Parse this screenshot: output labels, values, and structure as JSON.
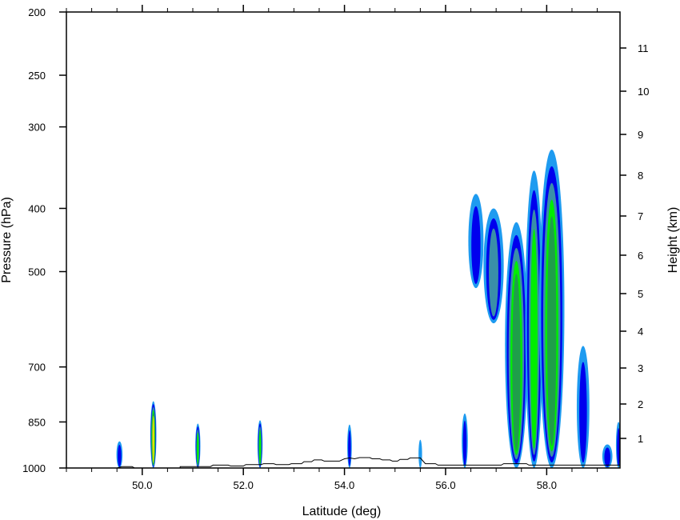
{
  "chart_data": {
    "type": "heatmap",
    "title": "",
    "xlabel": "Latitude (deg)",
    "ylabel": "Pressure (hPa)",
    "y2label": "Height (km)",
    "xlim": [
      48.5,
      59.45
    ],
    "ylim_pressure": [
      1000,
      200
    ],
    "y_scale": "log",
    "x_ticks": [
      "50.0",
      "52.0",
      "54.0",
      "56.0",
      "58.0"
    ],
    "x_tick_values": [
      50,
      52,
      54,
      56,
      58
    ],
    "y_ticks": [
      "200",
      "250",
      "300",
      "400",
      "500",
      "700",
      "850",
      "1000"
    ],
    "y_tick_values": [
      200,
      250,
      300,
      400,
      500,
      700,
      850,
      1000
    ],
    "y2_ticks": [
      "1",
      "2",
      "3",
      "4",
      "5",
      "6",
      "7",
      "8",
      "9",
      "10",
      "11"
    ],
    "y2_tick_values": [
      1,
      2,
      3,
      4,
      5,
      6,
      7,
      8,
      9,
      10,
      11
    ],
    "grid": false,
    "legend": "none",
    "colors": {
      "level1": "#1e9bf0",
      "level2": "#0000ee",
      "level3": "#3a8fa8",
      "level4": "#00ee00",
      "level5": "#1f9e4a",
      "level6": "#e6e600"
    },
    "cells": [
      {
        "lat": 49.55,
        "p_top": 910,
        "p_bottom": 1000,
        "w": 0.12,
        "levels": 2
      },
      {
        "lat": 50.22,
        "p_top": 790,
        "p_bottom": 1000,
        "w": 0.12,
        "levels": 6
      },
      {
        "lat": 51.1,
        "p_top": 855,
        "p_bottom": 1000,
        "w": 0.1,
        "levels": 4
      },
      {
        "lat": 52.33,
        "p_top": 845,
        "p_bottom": 1000,
        "w": 0.1,
        "levels": 4
      },
      {
        "lat": 54.1,
        "p_top": 858,
        "p_bottom": 1000,
        "w": 0.09,
        "levels": 2
      },
      {
        "lat": 55.5,
        "p_top": 905,
        "p_bottom": 1000,
        "w": 0.07,
        "levels": 1
      },
      {
        "lat": 56.38,
        "p_top": 825,
        "p_bottom": 1000,
        "w": 0.12,
        "levels": 2
      },
      {
        "lat": 56.6,
        "p_top": 380,
        "p_bottom": 530,
        "w": 0.3,
        "levels": 2
      },
      {
        "lat": 56.95,
        "p_top": 400,
        "p_bottom": 600,
        "w": 0.4,
        "levels": 3
      },
      {
        "lat": 57.4,
        "p_top": 420,
        "p_bottom": 1000,
        "w": 0.45,
        "levels": 5
      },
      {
        "lat": 57.75,
        "p_top": 350,
        "p_bottom": 1000,
        "w": 0.35,
        "levels": 4
      },
      {
        "lat": 58.1,
        "p_top": 325,
        "p_bottom": 1000,
        "w": 0.5,
        "levels": 5
      },
      {
        "lat": 58.72,
        "p_top": 650,
        "p_bottom": 1000,
        "w": 0.25,
        "levels": 2
      },
      {
        "lat": 59.2,
        "p_top": 920,
        "p_bottom": 1000,
        "w": 0.2,
        "levels": 2
      },
      {
        "lat": 59.42,
        "p_top": 850,
        "p_bottom": 1000,
        "w": 0.1,
        "levels": 2
      }
    ],
    "terrain": [
      [
        48.5,
        1000
      ],
      [
        49.5,
        1000
      ],
      [
        49.6,
        995
      ],
      [
        49.8,
        995
      ],
      [
        49.85,
        1000
      ],
      [
        50.75,
        1000
      ],
      [
        50.75,
        995
      ],
      [
        51.35,
        995
      ],
      [
        51.4,
        990
      ],
      [
        51.7,
        990
      ],
      [
        51.75,
        993
      ],
      [
        52.0,
        993
      ],
      [
        52.05,
        988
      ],
      [
        52.35,
        988
      ],
      [
        52.4,
        985
      ],
      [
        52.6,
        985
      ],
      [
        52.65,
        988
      ],
      [
        52.9,
        988
      ],
      [
        52.95,
        985
      ],
      [
        53.15,
        985
      ],
      [
        53.2,
        978
      ],
      [
        53.35,
        978
      ],
      [
        53.4,
        972
      ],
      [
        53.55,
        972
      ],
      [
        53.6,
        976
      ],
      [
        53.9,
        976
      ],
      [
        53.95,
        972
      ],
      [
        54.0,
        968
      ],
      [
        54.1,
        965
      ],
      [
        54.2,
        968
      ],
      [
        54.3,
        964
      ],
      [
        54.5,
        964
      ],
      [
        54.55,
        968
      ],
      [
        54.7,
        968
      ],
      [
        54.75,
        972
      ],
      [
        54.9,
        972
      ],
      [
        54.95,
        976
      ],
      [
        55.05,
        976
      ],
      [
        55.1,
        970
      ],
      [
        55.25,
        970
      ],
      [
        55.3,
        965
      ],
      [
        55.5,
        965
      ],
      [
        55.55,
        975
      ],
      [
        55.6,
        985
      ],
      [
        55.8,
        985
      ],
      [
        55.85,
        990
      ],
      [
        57.1,
        990
      ],
      [
        57.15,
        985
      ],
      [
        57.6,
        985
      ],
      [
        57.65,
        990
      ],
      [
        59.45,
        990
      ]
    ]
  }
}
